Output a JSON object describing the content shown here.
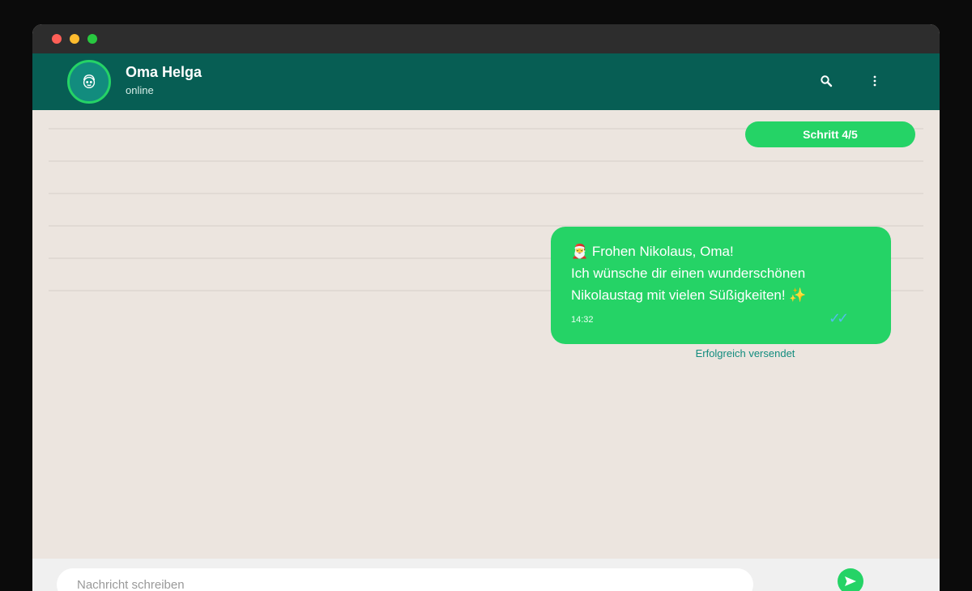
{
  "window": {
    "controls": [
      "close",
      "minimize",
      "zoom"
    ]
  },
  "header": {
    "avatar_icon": "grandma-face-icon",
    "contact_name": "Oma Helga",
    "contact_status": "online",
    "search_icon": "search-icon",
    "menu_icon": "more-vertical-icon"
  },
  "progress": {
    "step_label": "Schritt 4/5",
    "current": 4,
    "total": 5
  },
  "message": {
    "text": "🎅 Frohen Nikolaus, Oma!\nIch wünsche dir einen wunderschönen\nNikolaustag mit vielen Süßigkeiten! ✨",
    "time": "14:32",
    "ticks": "✓✓",
    "status": "Erfolgreich versendet"
  },
  "composer": {
    "placeholder": "Nachricht schreiben",
    "send_icon": "send-icon"
  },
  "colors": {
    "header": "#075e54",
    "accent": "#25d366",
    "chat_bg": "#ece5df",
    "ticks": "#53bdeb"
  }
}
